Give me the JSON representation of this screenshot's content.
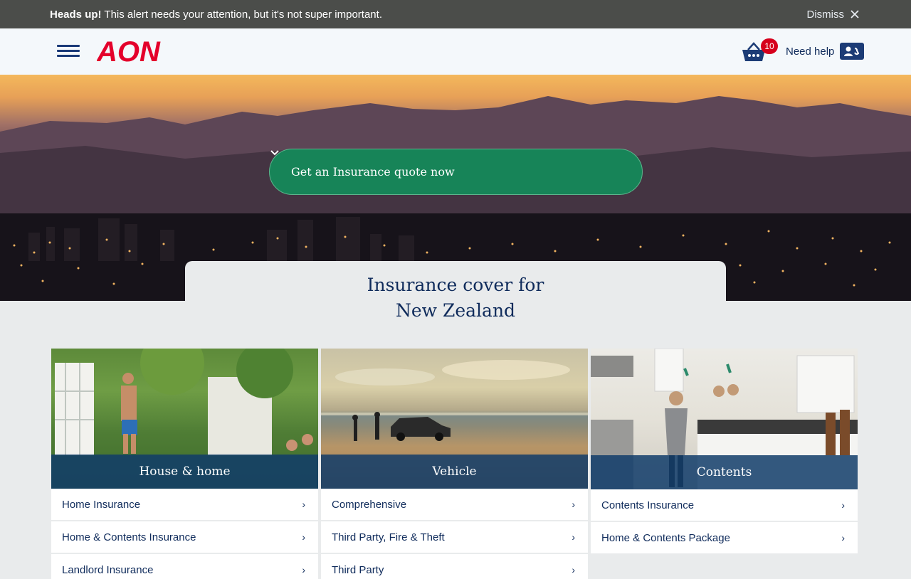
{
  "alert": {
    "heading": "Heads up!",
    "message": " This alert needs your attention, but it's not super important.",
    "dismiss_label": "Dismiss"
  },
  "header": {
    "brand": "AON",
    "cart_count": "10",
    "help_label": "Need help"
  },
  "hero": {
    "quote_label": "Get an Insurance quote now",
    "title_line1": "Insurance cover for",
    "title_line2": "New Zealand"
  },
  "categories": [
    {
      "label": "House & home",
      "links": [
        "Home Insurance",
        "Home & Contents Insurance",
        "Landlord Insurance"
      ]
    },
    {
      "label": "Vehicle",
      "links": [
        "Comprehensive",
        "Third Party, Fire & Theft",
        "Third Party"
      ]
    },
    {
      "label": "Contents",
      "links": [
        "Contents Insurance",
        "Home & Contents Package"
      ]
    }
  ],
  "colors": {
    "alert_bg": "#4b4d4a",
    "brand_red": "#e4002b",
    "navy": "#0f2b5b",
    "quote_green": "#178458",
    "badge_red": "#d6001c"
  },
  "icons": [
    "close-icon",
    "hamburger-icon",
    "cart-icon",
    "contact-card-icon",
    "chevron-down-icon",
    "chevron-right-icon"
  ]
}
